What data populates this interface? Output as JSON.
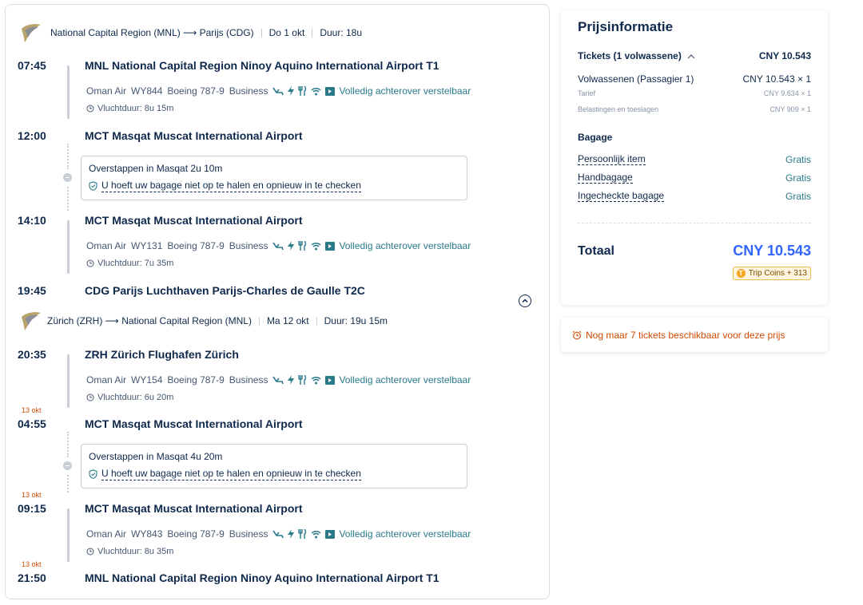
{
  "outbound": {
    "route": "National Capital Region (MNL) ⟶ Parijs (CDG)",
    "date": "Do 1 okt",
    "duration": "Duur: 18u",
    "segments": [
      {
        "dep_time": "07:45",
        "dep_airport": "MNL National Capital Region Ninoy Aquino International Airport T1",
        "airline": "Oman Air",
        "flight_no": "WY844",
        "aircraft": "Boeing 787-9",
        "cabin": "Business",
        "seat": "Volledig achterover verstelbaar",
        "flight_duration": "Vluchtduur: 8u 15m",
        "arr_time": "12:00",
        "arr_airport": "MCT Masqat Muscat International Airport"
      },
      {
        "dep_time": "14:10",
        "dep_airport": "MCT Masqat Muscat International Airport",
        "airline": "Oman Air",
        "flight_no": "WY131",
        "aircraft": "Boeing 787-9",
        "cabin": "Business",
        "seat": "Volledig achterover verstelbaar",
        "flight_duration": "Vluchtduur: 7u 35m",
        "arr_time": "19:45",
        "arr_airport": "CDG Parijs Luchthaven Parijs-Charles de Gaulle T2C"
      }
    ],
    "layover": {
      "title": "Overstappen in Masqat  2u 10m",
      "note": "U hoeft uw bagage niet op te halen en opnieuw in te checken"
    }
  },
  "inbound": {
    "route": "Zürich (ZRH) ⟶ National Capital Region (MNL)",
    "date": "Ma 12 okt",
    "duration": "Duur: 19u 15m",
    "segments": [
      {
        "dep_time": "20:35",
        "dep_airport": "ZRH Zürich Flughafen Zürich",
        "airline": "Oman Air",
        "flight_no": "WY154",
        "aircraft": "Boeing 787-9",
        "cabin": "Business",
        "seat": "Volledig achterover verstelbaar",
        "flight_duration": "Vluchtduur: 6u 20m",
        "arr_day": "13 okt",
        "arr_time": "04:55",
        "arr_airport": "MCT Masqat Muscat International Airport"
      },
      {
        "dep_day": "13 okt",
        "dep_time": "09:15",
        "dep_airport": "MCT Masqat Muscat International Airport",
        "airline": "Oman Air",
        "flight_no": "WY843",
        "aircraft": "Boeing 787-9",
        "cabin": "Business",
        "seat": "Volledig achterover verstelbaar",
        "flight_duration": "Vluchtduur: 8u 35m",
        "arr_day": "13 okt",
        "arr_time": "21:50",
        "arr_airport": "MNL National Capital Region Ninoy Aquino International Airport T1"
      }
    ],
    "layover": {
      "title": "Overstappen in Masqat  4u 20m",
      "note": "U hoeft uw bagage niet op te halen en opnieuw in te checken"
    }
  },
  "price": {
    "title": "Prijsinformatie",
    "tickets_label": "Tickets (1 volwassene)",
    "tickets_total": "CNY 10.543",
    "adult_label": "Volwassenen (Passagier 1)",
    "adult_value": "CNY 10.543 × 1",
    "fare_label": "Tarief",
    "fare_value": "CNY 9.634 × 1",
    "tax_label": "Belastingen en toeslagen",
    "tax_value": "CNY 909 × 1",
    "baggage_title": "Bagage",
    "baggage": [
      {
        "label": "Persoonlijk item",
        "value": "Gratis"
      },
      {
        "label": "Handbagage",
        "value": "Gratis"
      },
      {
        "label": "Ingecheckte bagage",
        "value": "Gratis"
      }
    ],
    "total_label": "Totaal",
    "total_value": "CNY 10.543",
    "coins": "Trip Coins + 313"
  },
  "alert": "Nog maar 7 tickets beschikbaar voor deze prijs",
  "colors": {
    "accent": "#3264ff",
    "teal": "#2a7a8c",
    "warning": "#d04a02",
    "text": "#0f294d"
  }
}
